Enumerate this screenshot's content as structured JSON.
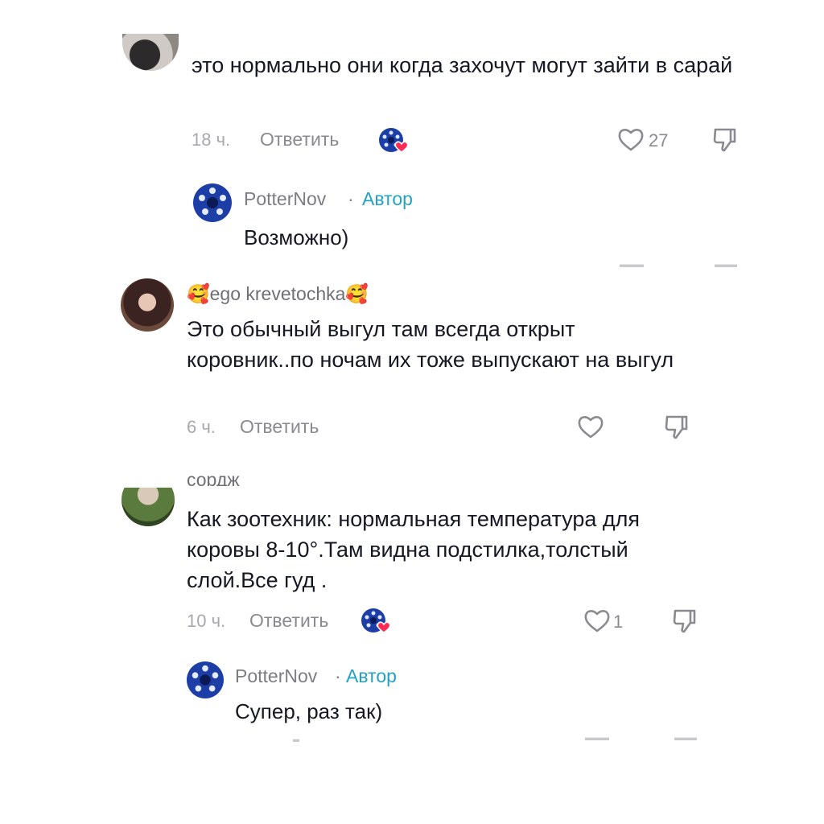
{
  "comments": [
    {
      "text": "это нормально они когда захочут могут зайти в сарай",
      "time": "18 ч.",
      "reply_label": "Ответить",
      "likes": "27",
      "liked_by_author": true,
      "reply": {
        "username": "PotterNov",
        "separator": "·",
        "badge": "Автор",
        "text": "Возможно)"
      }
    },
    {
      "username": "🥰ego krevetochka🥰",
      "text": "Это обычный выгул там всегда открыт коровник..по ночам их тоже выпускают на выгул",
      "time": "6 ч.",
      "reply_label": "Ответить",
      "likes": "",
      "liked_by_author": false
    },
    {
      "username_partial": "сордж",
      "text": "Как зоотехник: нормальная температура для коровы 8-10°.Там видна подстилка,толстый слой.Все гуд .",
      "time": "10 ч.",
      "reply_label": "Ответить",
      "likes": "1",
      "liked_by_author": true,
      "reply": {
        "username": "PotterNov",
        "separator": "·",
        "badge": "Автор",
        "text": "Супер, раз так)"
      }
    }
  ],
  "icons": {
    "like": "heart-outline-icon",
    "dislike": "thumbs-down-icon",
    "creator_liked": "creator-liked-badge-icon"
  },
  "colors": {
    "text": "#161823",
    "muted": "#8a8a90",
    "author_badge": "#20a3c4",
    "author_avatar": "#1d3ea6",
    "heart_badge": "#fe2c55"
  }
}
